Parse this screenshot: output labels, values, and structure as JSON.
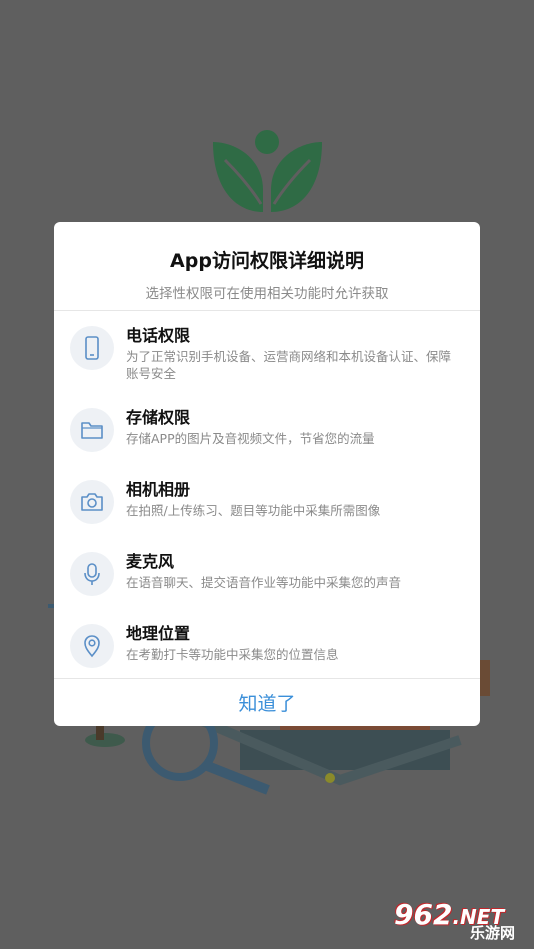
{
  "dialog": {
    "title": "App访问权限详细说明",
    "subtitle": "选择性权限可在使用相关功能时允许获取",
    "permissions": [
      {
        "title": "电话权限",
        "desc": "为了正常识别手机设备、运营商网络和本机设备认证、保障账号安全",
        "icon": "phone-icon"
      },
      {
        "title": "存储权限",
        "desc": "存储APP的图片及音视频文件，节省您的流量",
        "icon": "folder-icon"
      },
      {
        "title": "相机相册",
        "desc": "在拍照/上传练习、题目等功能中采集所需图像",
        "icon": "camera-icon"
      },
      {
        "title": "麦克风",
        "desc": "在语音聊天、提交语音作业等功能中采集您的声音",
        "icon": "microphone-icon"
      },
      {
        "title": "地理位置",
        "desc": "在考勤打卡等功能中采集您的位置信息",
        "icon": "location-pin-icon"
      }
    ],
    "confirm_label": "知道了"
  },
  "watermark": {
    "number": "962",
    "suffix": ".NET",
    "name": "乐游网"
  },
  "colors": {
    "accent": "#3b8fd9",
    "icon_stroke": "#5b8fc7",
    "logo_green": "#2f6b45"
  }
}
